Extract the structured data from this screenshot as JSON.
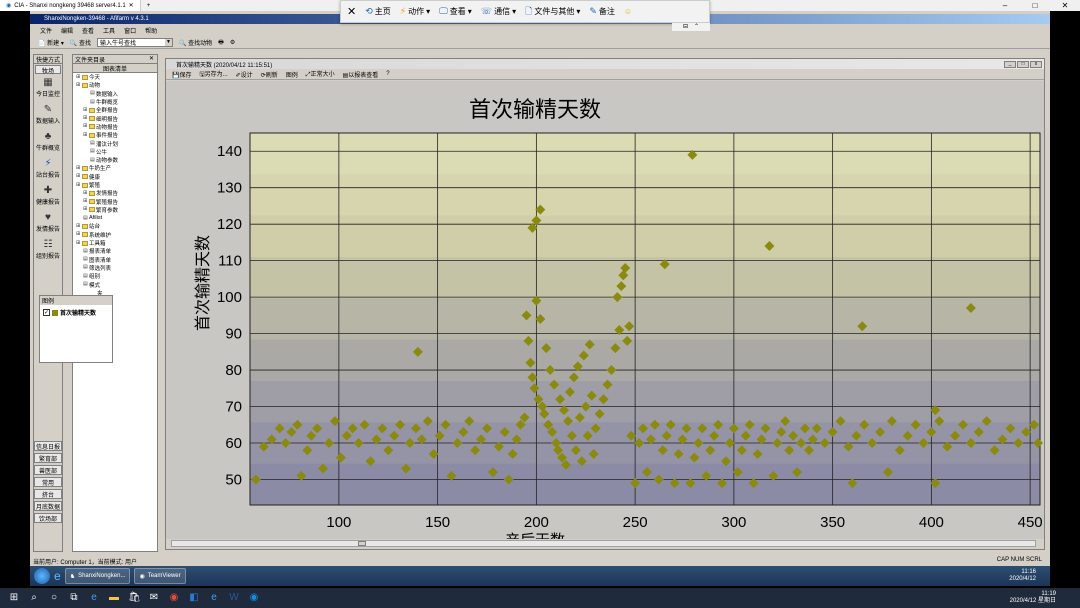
{
  "tv_window": {
    "tab_title": "CIA - Shanxi nongkeng 39468 server4.1.1",
    "controls": [
      "–",
      "□",
      "✕"
    ]
  },
  "app": {
    "title": "ShanxiNongken-39468 - Afifarm v 4.3.1",
    "menu": [
      "文件",
      "编辑",
      "查看",
      "工具",
      "窗口",
      "帮助"
    ],
    "toolbar": {
      "new": "新建",
      "search": "查找",
      "cow_search_placeholder": "输入牛号查找",
      "find_action": "查找动物"
    }
  },
  "tv_toolbar": {
    "items": [
      "主页",
      "动作",
      "查看",
      "通信",
      "文件与其他",
      "备注"
    ]
  },
  "sidebar": {
    "header": "快捷方式",
    "tab": "牧场",
    "items": [
      "今日监控",
      "数据输入",
      "牛群概览",
      "站台报告",
      "健康报告",
      "发情报告",
      "组别报告",
      "图例"
    ],
    "bottom": [
      "信息日报",
      "繁育部",
      "兽医部",
      "常用",
      "挤台",
      "月底数据",
      "饮场部"
    ]
  },
  "tree": {
    "header": "文件夹目录",
    "subheader": "图表清单",
    "nodes": [
      {
        "label": "今天",
        "indent": 0,
        "type": "folder"
      },
      {
        "label": "动物",
        "indent": 0,
        "type": "folder"
      },
      {
        "label": "数据输入",
        "indent": 2,
        "type": "doc"
      },
      {
        "label": "牛群概览",
        "indent": 2,
        "type": "doc"
      },
      {
        "label": "全群报告",
        "indent": 1,
        "type": "folder"
      },
      {
        "label": "细明报告",
        "indent": 1,
        "type": "folder"
      },
      {
        "label": "动物报告",
        "indent": 1,
        "type": "folder"
      },
      {
        "label": "事件报告",
        "indent": 1,
        "type": "folder"
      },
      {
        "label": "潘汰计划",
        "indent": 2,
        "type": "doc"
      },
      {
        "label": "公牛",
        "indent": 2,
        "type": "doc"
      },
      {
        "label": "动物参数",
        "indent": 2,
        "type": "doc"
      },
      {
        "label": "牛奶生产",
        "indent": 0,
        "type": "folder"
      },
      {
        "label": "健康",
        "indent": 0,
        "type": "folder"
      },
      {
        "label": "繁殖",
        "indent": 0,
        "type": "folder"
      },
      {
        "label": "发情报告",
        "indent": 1,
        "type": "folder"
      },
      {
        "label": "繁殖报告",
        "indent": 1,
        "type": "folder"
      },
      {
        "label": "繁育参数",
        "indent": 1,
        "type": "folder"
      },
      {
        "label": "Afilist",
        "indent": 1,
        "type": "doc"
      },
      {
        "label": "站台",
        "indent": 0,
        "type": "folder"
      },
      {
        "label": "系统维护",
        "indent": 0,
        "type": "folder"
      },
      {
        "label": "工具箱",
        "indent": 0,
        "type": "folder"
      },
      {
        "label": "报表清单",
        "indent": 1,
        "type": "doc"
      },
      {
        "label": "图表清单",
        "indent": 1,
        "type": "doc"
      },
      {
        "label": "筛选列表",
        "indent": 1,
        "type": "doc"
      },
      {
        "label": "组别",
        "indent": 1,
        "type": "doc"
      },
      {
        "label": "模式",
        "indent": 1,
        "type": "doc"
      },
      {
        "label": "夹",
        "indent": 3,
        "type": "none"
      }
    ]
  },
  "legend": {
    "title": "图例",
    "entry": "首次输精天数",
    "checked": "✓"
  },
  "chart_window": {
    "title": "首次输精天数 (2020/04/12 11:15:51)",
    "tools": [
      "保存",
      "另存为...",
      "设计",
      "刷新",
      "图例",
      "正常大小",
      "以报表查看"
    ]
  },
  "status": {
    "left": "当前用户: Computer 1，当前模式: 用户",
    "right": "CAP  NUM  SCRL"
  },
  "remote_taskbar": {
    "buttons": [
      "ShanxiNongken...",
      "TeamViewer"
    ],
    "time": "11:16",
    "date": "2020/4/12"
  },
  "host_taskbar": {
    "time": "11:19",
    "date": "2020/4/12 星期日",
    "lang": "中"
  },
  "colors": {
    "marker": "#8a8a10",
    "band_top": "#d8d6a8",
    "band_bottom": "#8a889c"
  },
  "chart_data": {
    "type": "scatter",
    "title": "首次输精天数",
    "xlabel": "产后天数",
    "ylabel": "首次输精天数",
    "xlim": [
      55,
      455
    ],
    "ylim": [
      43,
      145
    ],
    "xticks": [
      100,
      150,
      200,
      250,
      300,
      350,
      400,
      450
    ],
    "yticks": [
      50,
      60,
      70,
      80,
      90,
      100,
      110,
      120,
      130,
      140
    ],
    "grid": true,
    "series": [
      {
        "name": "首次输精天数",
        "points": [
          [
            58,
            50
          ],
          [
            62,
            59
          ],
          [
            66,
            61
          ],
          [
            70,
            64
          ],
          [
            73,
            60
          ],
          [
            76,
            63
          ],
          [
            79,
            65
          ],
          [
            81,
            51
          ],
          [
            84,
            58
          ],
          [
            86,
            62
          ],
          [
            89,
            64
          ],
          [
            92,
            53
          ],
          [
            95,
            60
          ],
          [
            98,
            66
          ],
          [
            101,
            56
          ],
          [
            104,
            62
          ],
          [
            107,
            64
          ],
          [
            110,
            60
          ],
          [
            113,
            65
          ],
          [
            116,
            55
          ],
          [
            119,
            61
          ],
          [
            122,
            64
          ],
          [
            125,
            58
          ],
          [
            128,
            62
          ],
          [
            131,
            65
          ],
          [
            134,
            53
          ],
          [
            136,
            60
          ],
          [
            139,
            64
          ],
          [
            140,
            85
          ],
          [
            142,
            61
          ],
          [
            145,
            66
          ],
          [
            148,
            57
          ],
          [
            151,
            62
          ],
          [
            154,
            65
          ],
          [
            157,
            51
          ],
          [
            160,
            60
          ],
          [
            163,
            63
          ],
          [
            166,
            66
          ],
          [
            169,
            58
          ],
          [
            172,
            61
          ],
          [
            175,
            64
          ],
          [
            178,
            52
          ],
          [
            181,
            59
          ],
          [
            184,
            63
          ],
          [
            186,
            50
          ],
          [
            188,
            57
          ],
          [
            190,
            61
          ],
          [
            192,
            65
          ],
          [
            194,
            67
          ],
          [
            195,
            95
          ],
          [
            196,
            88
          ],
          [
            197,
            82
          ],
          [
            198,
            78
          ],
          [
            198,
            119
          ],
          [
            199,
            75
          ],
          [
            200,
            121
          ],
          [
            200,
            99
          ],
          [
            201,
            72
          ],
          [
            202,
            94
          ],
          [
            202,
            124
          ],
          [
            203,
            70
          ],
          [
            204,
            68
          ],
          [
            205,
            86
          ],
          [
            206,
            65
          ],
          [
            207,
            80
          ],
          [
            208,
            63
          ],
          [
            209,
            76
          ],
          [
            210,
            60
          ],
          [
            211,
            58
          ],
          [
            212,
            72
          ],
          [
            213,
            56
          ],
          [
            214,
            69
          ],
          [
            215,
            54
          ],
          [
            216,
            66
          ],
          [
            217,
            74
          ],
          [
            218,
            62
          ],
          [
            219,
            78
          ],
          [
            220,
            58
          ],
          [
            221,
            81
          ],
          [
            222,
            67
          ],
          [
            223,
            55
          ],
          [
            224,
            84
          ],
          [
            225,
            70
          ],
          [
            226,
            62
          ],
          [
            227,
            87
          ],
          [
            228,
            73
          ],
          [
            229,
            57
          ],
          [
            230,
            64
          ],
          [
            232,
            68
          ],
          [
            234,
            72
          ],
          [
            236,
            76
          ],
          [
            238,
            80
          ],
          [
            240,
            86
          ],
          [
            241,
            100
          ],
          [
            242,
            91
          ],
          [
            243,
            103
          ],
          [
            244,
            106
          ],
          [
            245,
            108
          ],
          [
            246,
            88
          ],
          [
            247,
            92
          ],
          [
            248,
            62
          ],
          [
            250,
            49
          ],
          [
            252,
            60
          ],
          [
            254,
            64
          ],
          [
            256,
            52
          ],
          [
            258,
            61
          ],
          [
            260,
            65
          ],
          [
            262,
            50
          ],
          [
            264,
            58
          ],
          [
            265,
            109
          ],
          [
            266,
            62
          ],
          [
            268,
            65
          ],
          [
            270,
            49
          ],
          [
            272,
            57
          ],
          [
            274,
            61
          ],
          [
            276,
            64
          ],
          [
            278,
            49
          ],
          [
            279,
            139
          ],
          [
            280,
            56
          ],
          [
            282,
            60
          ],
          [
            284,
            64
          ],
          [
            286,
            51
          ],
          [
            288,
            58
          ],
          [
            290,
            62
          ],
          [
            292,
            65
          ],
          [
            294,
            49
          ],
          [
            296,
            55
          ],
          [
            298,
            60
          ],
          [
            300,
            64
          ],
          [
            302,
            52
          ],
          [
            304,
            58
          ],
          [
            306,
            62
          ],
          [
            308,
            65
          ],
          [
            310,
            49
          ],
          [
            312,
            57
          ],
          [
            314,
            61
          ],
          [
            316,
            64
          ],
          [
            318,
            114
          ],
          [
            320,
            51
          ],
          [
            322,
            60
          ],
          [
            324,
            63
          ],
          [
            326,
            66
          ],
          [
            328,
            58
          ],
          [
            330,
            62
          ],
          [
            332,
            52
          ],
          [
            334,
            60
          ],
          [
            336,
            64
          ],
          [
            338,
            58
          ],
          [
            340,
            61
          ],
          [
            342,
            64
          ],
          [
            346,
            60
          ],
          [
            350,
            63
          ],
          [
            354,
            66
          ],
          [
            358,
            59
          ],
          [
            360,
            49
          ],
          [
            362,
            62
          ],
          [
            365,
            92
          ],
          [
            366,
            65
          ],
          [
            370,
            60
          ],
          [
            374,
            63
          ],
          [
            378,
            52
          ],
          [
            380,
            66
          ],
          [
            384,
            58
          ],
          [
            388,
            62
          ],
          [
            392,
            65
          ],
          [
            396,
            60
          ],
          [
            400,
            63
          ],
          [
            402,
            49
          ],
          [
            402,
            69
          ],
          [
            404,
            66
          ],
          [
            408,
            59
          ],
          [
            412,
            62
          ],
          [
            416,
            65
          ],
          [
            420,
            97
          ],
          [
            420,
            60
          ],
          [
            424,
            63
          ],
          [
            428,
            66
          ],
          [
            432,
            58
          ],
          [
            436,
            61
          ],
          [
            440,
            64
          ],
          [
            444,
            60
          ],
          [
            448,
            63
          ],
          [
            452,
            65
          ],
          [
            454,
            60
          ]
        ]
      }
    ]
  }
}
